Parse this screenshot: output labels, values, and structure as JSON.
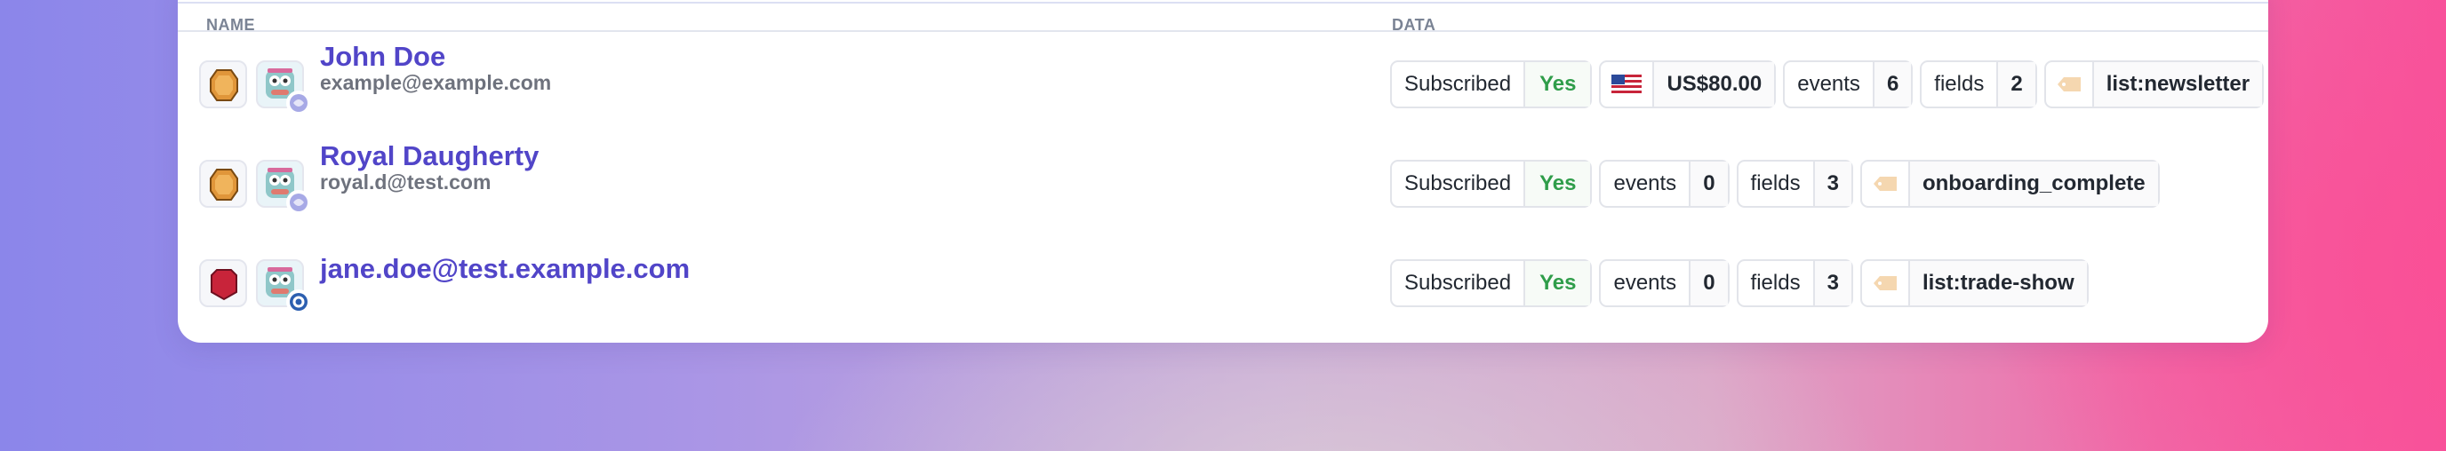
{
  "table": {
    "headers": {
      "name": "NAME",
      "data": "DATA"
    }
  },
  "rows": [
    {
      "name": "John Doe",
      "email": "example@example.com",
      "badge_color": "#d98a2b",
      "subscribed_label": "Subscribed",
      "subscribed_value": "Yes",
      "amount": "US$80.00",
      "events_label": "events",
      "events_value": "6",
      "fields_label": "fields",
      "fields_value": "2",
      "tag": "list:newsletter"
    },
    {
      "name": "Royal Daugherty",
      "email": "royal.d@test.com",
      "badge_color": "#d98a2b",
      "subscribed_label": "Subscribed",
      "subscribed_value": "Yes",
      "events_label": "events",
      "events_value": "0",
      "fields_label": "fields",
      "fields_value": "3",
      "tag": "onboarding_complete"
    },
    {
      "name": "jane.doe@test.example.com",
      "badge_color": "#c8243a",
      "subscribed_label": "Subscribed",
      "subscribed_value": "Yes",
      "events_label": "events",
      "events_value": "0",
      "fields_label": "fields",
      "fields_value": "3",
      "tag": "list:trade-show"
    }
  ],
  "colors": {
    "accent": "#5145c8",
    "yes": "#2f9d4a"
  }
}
